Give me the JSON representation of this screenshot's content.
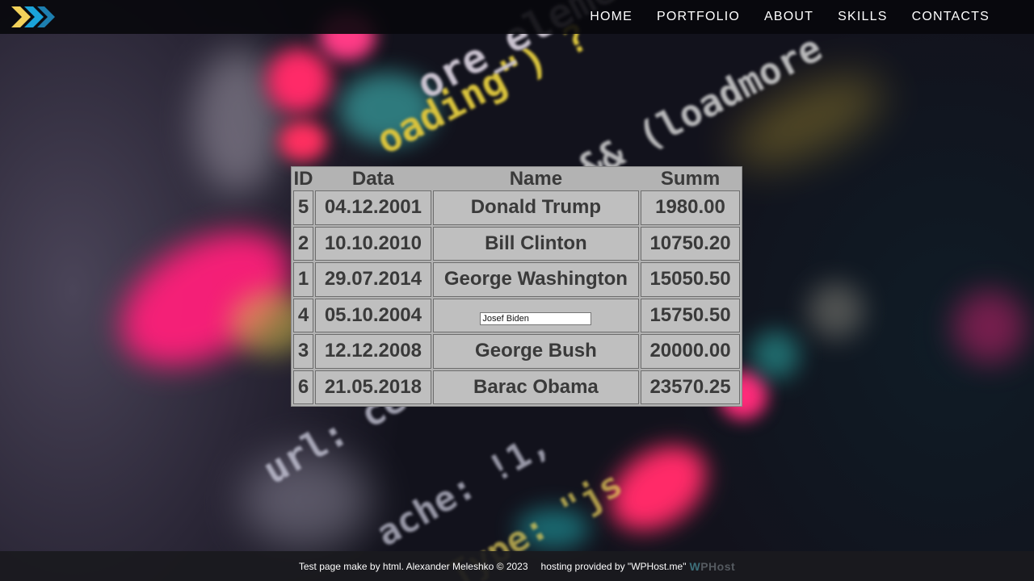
{
  "header": {
    "logo_icon": "double-chevron-logo-icon",
    "nav": [
      "HOME",
      "PORTFOLIO",
      "ABOUT",
      "SKILLS",
      "CONTACTS"
    ]
  },
  "table": {
    "columns": [
      "ID",
      "Data",
      "Name",
      "Summ"
    ],
    "rows": [
      {
        "id": "5",
        "date": "04.12.2001",
        "name": "Donald Trump",
        "summ": "1980.00",
        "editing": false
      },
      {
        "id": "2",
        "date": "10.10.2010",
        "name": "Bill Clinton",
        "summ": "10750.20",
        "editing": false
      },
      {
        "id": "1",
        "date": "29.07.2014",
        "name": "George Washington",
        "summ": "15050.50",
        "editing": false
      },
      {
        "id": "4",
        "date": "05.10.2004",
        "name": "Josef Biden",
        "summ": "15750.50",
        "editing": true
      },
      {
        "id": "3",
        "date": "12.12.2008",
        "name": "George Bush",
        "summ": "20000.00",
        "editing": false
      },
      {
        "id": "6",
        "date": "21.05.2018",
        "name": "Barac Obama",
        "summ": "23570.25",
        "editing": false
      }
    ]
  },
  "footer": {
    "text": "Test page make by html. Alexander Meleshko © 2023",
    "hosting": "hosting provided by \"WPHost.me\"",
    "logo_w": "W",
    "logo_rest": "PHost"
  },
  "colors": {
    "accent_yellow": "#f2d15a",
    "accent_blue": "#1aa3d9",
    "table_bg": "#bfbfbf",
    "table_text": "#3a3a3a"
  }
}
